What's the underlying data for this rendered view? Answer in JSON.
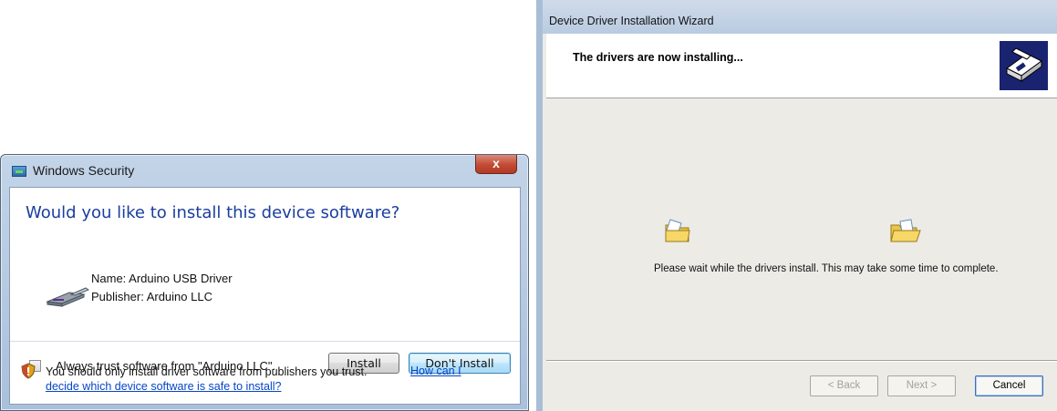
{
  "security_dialog": {
    "title": "Windows Security",
    "close_glyph": "x",
    "heading": "Would you like to install this device software?",
    "name_line": "Name: Arduino USB Driver",
    "publisher_line": "Publisher: Arduino LLC",
    "trust_checkbox_label": "Always trust software from \"Arduino LLC\".",
    "trust_checkbox_checked": false,
    "install_label": "Install",
    "dont_install_label": "Don't Install",
    "warning_text": "You should only install driver software from publishers you trust.",
    "help_link_part1": "How can I",
    "help_link_part2": "decide which device software is safe to install?",
    "icons": [
      "shield-icon",
      "usb-plug-icon",
      "window-icon",
      "close-icon"
    ],
    "colors": {
      "heading": "#1a3e9e",
      "link": "#0645c8",
      "close_button": "#c24a33"
    }
  },
  "wizard": {
    "title": "Device Driver Installation Wizard",
    "header_title": "The drivers are now installing...",
    "message": "Please wait while the drivers install. This may take some time to complete.",
    "back_label": "< Back",
    "next_label": "Next >",
    "cancel_label": "Cancel",
    "back_enabled": false,
    "next_enabled": false,
    "icons": [
      "hardware-wizard-icon",
      "folder-icon",
      "folder-icon"
    ],
    "colors": {
      "header_icon_bg": "#1a2370",
      "disabled_text": "#a3a29c"
    }
  }
}
